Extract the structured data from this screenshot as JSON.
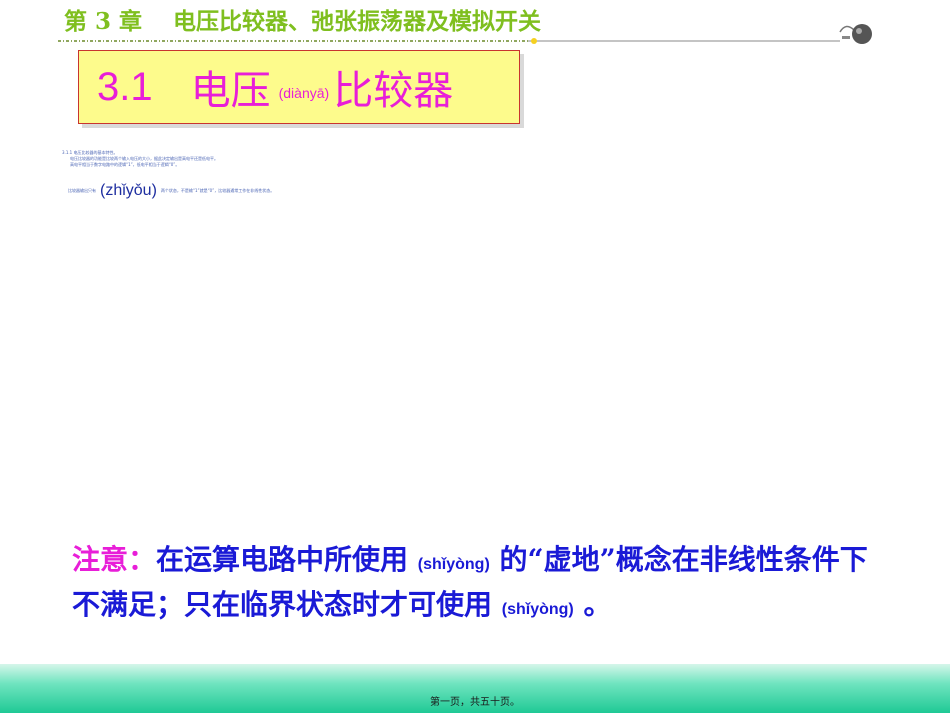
{
  "header": {
    "chapter_title": "第 3 章　 电压比较器、弛张振荡器及模拟开关"
  },
  "section": {
    "number": "3.1",
    "title_part1": "电压",
    "title_pinyin": "(diànyā)",
    "title_part2": "比较器"
  },
  "body_small": {
    "line1": "3.1.1 电压比较器的基本特性。",
    "line2": "电压比较器的功能是比较两个输入电压的大小，据此决定输出是高电平还是低电平。",
    "line3": "高电平相当于数字电路中的逻辑“1”，低电平相当于逻辑“0”。",
    "row_prefix": "比较器输出只有",
    "row_pinyin": "(zhǐyǒu)",
    "row_suffix": "两个状态，不是输“1”就是“0”，比较器通常工作在非线性状态。"
  },
  "note": {
    "label": "注意：",
    "text1": "在运算电路中所使用",
    "pinyin1": "(shǐyòng)",
    "text2": "的“虚地”概念在非线性条件下不满足；只在临界状态时才可使用",
    "pinyin2": "(shǐyòng)",
    "text3": "。"
  },
  "footer": {
    "page_text": "第一页，共五十页。"
  },
  "colors": {
    "chapter": "#7fbf1f",
    "accent": "#e81ed8",
    "note": "#1a1ad6",
    "box_fill": "#fdfb8c",
    "footer": "#1fc995"
  },
  "icons": {
    "header_ornament": "bell-ornament-icon"
  }
}
